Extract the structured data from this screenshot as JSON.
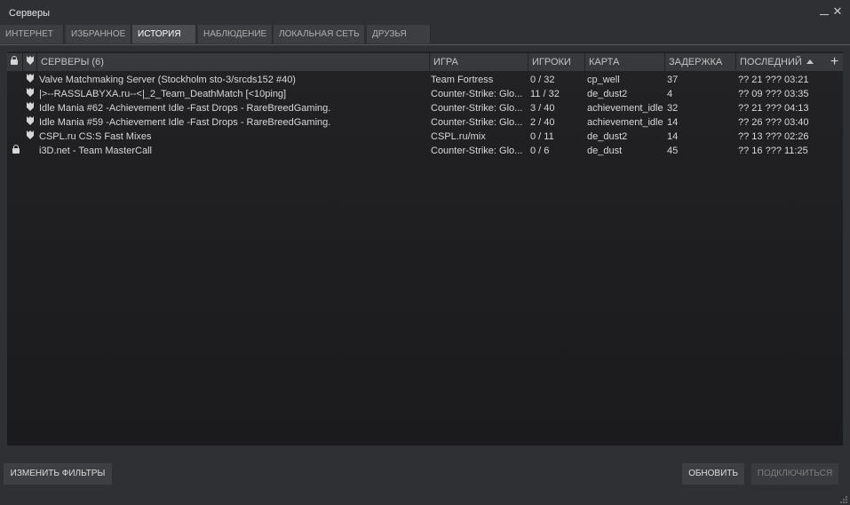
{
  "window": {
    "title": "Серверы"
  },
  "tabs": [
    {
      "label": "ИНТЕРНЕТ"
    },
    {
      "label": "ИЗБРАННОЕ"
    },
    {
      "label": "ИСТОРИЯ"
    },
    {
      "label": "НАБЛЮДЕНИЕ"
    },
    {
      "label": "ЛОКАЛЬНАЯ СЕТЬ"
    },
    {
      "label": "ДРУЗЬЯ"
    }
  ],
  "active_tab": "ИСТОРИЯ",
  "columns": {
    "servers": "СЕРВЕРЫ (6)",
    "game": "ИГРА",
    "players": "ИГРОКИ",
    "map": "КАРТА",
    "ping": "ЗАДЕРЖКА",
    "last": "ПОСЛЕДНИЙ",
    "add": "+"
  },
  "sort": {
    "column": "ПОСЛЕДНИЙ",
    "direction": "ascending"
  },
  "servers": [
    {
      "locked": false,
      "vac": true,
      "name": "Valve Matchmaking Server (Stockholm sto-3/srcds152 #40)",
      "game": "Team Fortress",
      "players": "0 / 32",
      "map": "cp_well",
      "ping": "37",
      "last": "?? 21 ??? 03:21"
    },
    {
      "locked": false,
      "vac": true,
      "name": "|>--RASSLABYXA.ru--<|_2_Team_DeathMatch [<10ping]",
      "game": "Counter-Strike: Glo...",
      "players": "11 / 32",
      "map": "de_dust2",
      "ping": "4",
      "last": "?? 09 ??? 03:35"
    },
    {
      "locked": false,
      "vac": true,
      "name": "Idle Mania #62 -Achievement Idle -Fast Drops - RareBreedGaming.",
      "game": "Counter-Strike: Glo...",
      "players": "3 / 40",
      "map": "achievement_idle",
      "ping": "32",
      "last": "?? 21 ??? 04:13"
    },
    {
      "locked": false,
      "vac": true,
      "name": "Idle Mania #59 -Achievement Idle -Fast Drops - RareBreedGaming.",
      "game": "Counter-Strike: Glo...",
      "players": "2 / 40",
      "map": "achievement_idle",
      "ping": "14",
      "last": "?? 26 ??? 03:40"
    },
    {
      "locked": false,
      "vac": true,
      "name": "CSPL.ru CS:S Fast Mixes",
      "game": "CSPL.ru/mix",
      "players": "0 / 11",
      "map": "de_dust2",
      "ping": "14",
      "last": "?? 13 ??? 02:26"
    },
    {
      "locked": true,
      "vac": false,
      "name": "i3D.net - Team MasterCall",
      "game": "Counter-Strike: Glo...",
      "players": "0 / 6",
      "map": "de_dust",
      "ping": "45",
      "last": "?? 16 ??? 11:25"
    }
  ],
  "buttons": {
    "change_filters": "ИЗМЕНИТЬ ФИЛЬТРЫ",
    "refresh": "ОБНОВИТЬ",
    "connect": "ПОДКЛЮЧИТЬСЯ"
  }
}
